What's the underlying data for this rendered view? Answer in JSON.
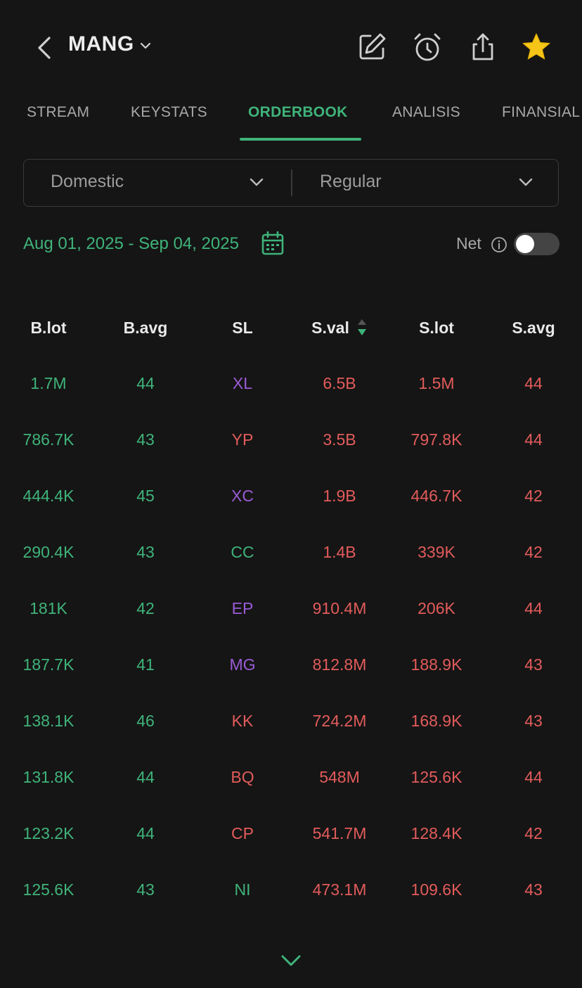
{
  "header": {
    "ticker": "MANG"
  },
  "tabs": [
    {
      "label": "STREAM"
    },
    {
      "label": "KEYSTATS"
    },
    {
      "label": "ORDERBOOK"
    },
    {
      "label": "ANALISIS"
    },
    {
      "label": "FINANSIAL"
    }
  ],
  "filters": {
    "market": "Domestic",
    "board": "Regular"
  },
  "date_range": "Aug 01, 2025 - Sep 04, 2025",
  "net": {
    "label": "Net",
    "enabled": false
  },
  "table": {
    "headers": [
      "B.lot",
      "B.avg",
      "SL",
      "S.val",
      "S.lot",
      "S.avg"
    ],
    "sort_column": "S.val",
    "rows": [
      {
        "blot": "1.7M",
        "bavg": "44",
        "sl": "XL",
        "sl_color": "purple",
        "sval": "6.5B",
        "slot": "1.5M",
        "savg": "44"
      },
      {
        "blot": "786.7K",
        "bavg": "43",
        "sl": "YP",
        "sl_color": "red",
        "sval": "3.5B",
        "slot": "797.8K",
        "savg": "44"
      },
      {
        "blot": "444.4K",
        "bavg": "45",
        "sl": "XC",
        "sl_color": "purple",
        "sval": "1.9B",
        "slot": "446.7K",
        "savg": "42"
      },
      {
        "blot": "290.4K",
        "bavg": "43",
        "sl": "CC",
        "sl_color": "green",
        "sval": "1.4B",
        "slot": "339K",
        "savg": "42"
      },
      {
        "blot": "181K",
        "bavg": "42",
        "sl": "EP",
        "sl_color": "purple",
        "sval": "910.4M",
        "slot": "206K",
        "savg": "44"
      },
      {
        "blot": "187.7K",
        "bavg": "41",
        "sl": "MG",
        "sl_color": "purple",
        "sval": "812.8M",
        "slot": "188.9K",
        "savg": "43"
      },
      {
        "blot": "138.1K",
        "bavg": "46",
        "sl": "KK",
        "sl_color": "red",
        "sval": "724.2M",
        "slot": "168.9K",
        "savg": "43"
      },
      {
        "blot": "131.8K",
        "bavg": "44",
        "sl": "BQ",
        "sl_color": "red",
        "sval": "548M",
        "slot": "125.6K",
        "savg": "44"
      },
      {
        "blot": "123.2K",
        "bavg": "44",
        "sl": "CP",
        "sl_color": "red",
        "sval": "541.7M",
        "slot": "128.4K",
        "savg": "42"
      },
      {
        "blot": "125.6K",
        "bavg": "43",
        "sl": "NI",
        "sl_color": "green",
        "sval": "473.1M",
        "slot": "109.6K",
        "savg": "43"
      }
    ]
  },
  "colors": {
    "buy": "#3fb37a",
    "sell": "#e35b5b",
    "foreign": "#9a5bd6",
    "accent": "#3fb37a",
    "star": "#f5c518",
    "background": "#151515"
  },
  "icons": [
    "back-arrow-icon",
    "chevron-down-icon",
    "edit-icon",
    "alarm-icon",
    "share-icon",
    "star-icon",
    "calendar-icon",
    "info-icon",
    "sort-icon"
  ]
}
